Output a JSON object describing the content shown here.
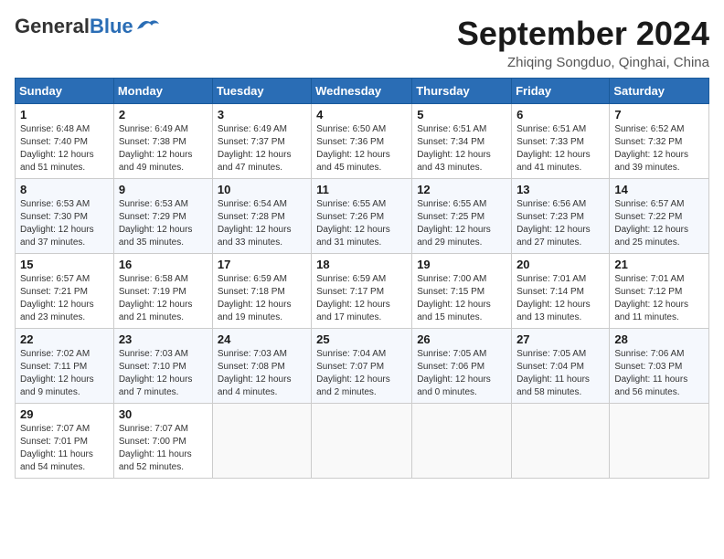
{
  "header": {
    "logo_general": "General",
    "logo_blue": "Blue",
    "month_title": "September 2024",
    "location": "Zhiqing Songduo, Qinghai, China"
  },
  "weekdays": [
    "Sunday",
    "Monday",
    "Tuesday",
    "Wednesday",
    "Thursday",
    "Friday",
    "Saturday"
  ],
  "weeks": [
    [
      {
        "day": "1",
        "info": "Sunrise: 6:48 AM\nSunset: 7:40 PM\nDaylight: 12 hours\nand 51 minutes."
      },
      {
        "day": "2",
        "info": "Sunrise: 6:49 AM\nSunset: 7:38 PM\nDaylight: 12 hours\nand 49 minutes."
      },
      {
        "day": "3",
        "info": "Sunrise: 6:49 AM\nSunset: 7:37 PM\nDaylight: 12 hours\nand 47 minutes."
      },
      {
        "day": "4",
        "info": "Sunrise: 6:50 AM\nSunset: 7:36 PM\nDaylight: 12 hours\nand 45 minutes."
      },
      {
        "day": "5",
        "info": "Sunrise: 6:51 AM\nSunset: 7:34 PM\nDaylight: 12 hours\nand 43 minutes."
      },
      {
        "day": "6",
        "info": "Sunrise: 6:51 AM\nSunset: 7:33 PM\nDaylight: 12 hours\nand 41 minutes."
      },
      {
        "day": "7",
        "info": "Sunrise: 6:52 AM\nSunset: 7:32 PM\nDaylight: 12 hours\nand 39 minutes."
      }
    ],
    [
      {
        "day": "8",
        "info": "Sunrise: 6:53 AM\nSunset: 7:30 PM\nDaylight: 12 hours\nand 37 minutes."
      },
      {
        "day": "9",
        "info": "Sunrise: 6:53 AM\nSunset: 7:29 PM\nDaylight: 12 hours\nand 35 minutes."
      },
      {
        "day": "10",
        "info": "Sunrise: 6:54 AM\nSunset: 7:28 PM\nDaylight: 12 hours\nand 33 minutes."
      },
      {
        "day": "11",
        "info": "Sunrise: 6:55 AM\nSunset: 7:26 PM\nDaylight: 12 hours\nand 31 minutes."
      },
      {
        "day": "12",
        "info": "Sunrise: 6:55 AM\nSunset: 7:25 PM\nDaylight: 12 hours\nand 29 minutes."
      },
      {
        "day": "13",
        "info": "Sunrise: 6:56 AM\nSunset: 7:23 PM\nDaylight: 12 hours\nand 27 minutes."
      },
      {
        "day": "14",
        "info": "Sunrise: 6:57 AM\nSunset: 7:22 PM\nDaylight: 12 hours\nand 25 minutes."
      }
    ],
    [
      {
        "day": "15",
        "info": "Sunrise: 6:57 AM\nSunset: 7:21 PM\nDaylight: 12 hours\nand 23 minutes."
      },
      {
        "day": "16",
        "info": "Sunrise: 6:58 AM\nSunset: 7:19 PM\nDaylight: 12 hours\nand 21 minutes."
      },
      {
        "day": "17",
        "info": "Sunrise: 6:59 AM\nSunset: 7:18 PM\nDaylight: 12 hours\nand 19 minutes."
      },
      {
        "day": "18",
        "info": "Sunrise: 6:59 AM\nSunset: 7:17 PM\nDaylight: 12 hours\nand 17 minutes."
      },
      {
        "day": "19",
        "info": "Sunrise: 7:00 AM\nSunset: 7:15 PM\nDaylight: 12 hours\nand 15 minutes."
      },
      {
        "day": "20",
        "info": "Sunrise: 7:01 AM\nSunset: 7:14 PM\nDaylight: 12 hours\nand 13 minutes."
      },
      {
        "day": "21",
        "info": "Sunrise: 7:01 AM\nSunset: 7:12 PM\nDaylight: 12 hours\nand 11 minutes."
      }
    ],
    [
      {
        "day": "22",
        "info": "Sunrise: 7:02 AM\nSunset: 7:11 PM\nDaylight: 12 hours\nand 9 minutes."
      },
      {
        "day": "23",
        "info": "Sunrise: 7:03 AM\nSunset: 7:10 PM\nDaylight: 12 hours\nand 7 minutes."
      },
      {
        "day": "24",
        "info": "Sunrise: 7:03 AM\nSunset: 7:08 PM\nDaylight: 12 hours\nand 4 minutes."
      },
      {
        "day": "25",
        "info": "Sunrise: 7:04 AM\nSunset: 7:07 PM\nDaylight: 12 hours\nand 2 minutes."
      },
      {
        "day": "26",
        "info": "Sunrise: 7:05 AM\nSunset: 7:06 PM\nDaylight: 12 hours\nand 0 minutes."
      },
      {
        "day": "27",
        "info": "Sunrise: 7:05 AM\nSunset: 7:04 PM\nDaylight: 11 hours\nand 58 minutes."
      },
      {
        "day": "28",
        "info": "Sunrise: 7:06 AM\nSunset: 7:03 PM\nDaylight: 11 hours\nand 56 minutes."
      }
    ],
    [
      {
        "day": "29",
        "info": "Sunrise: 7:07 AM\nSunset: 7:01 PM\nDaylight: 11 hours\nand 54 minutes."
      },
      {
        "day": "30",
        "info": "Sunrise: 7:07 AM\nSunset: 7:00 PM\nDaylight: 11 hours\nand 52 minutes."
      },
      {
        "day": "",
        "info": ""
      },
      {
        "day": "",
        "info": ""
      },
      {
        "day": "",
        "info": ""
      },
      {
        "day": "",
        "info": ""
      },
      {
        "day": "",
        "info": ""
      }
    ]
  ]
}
